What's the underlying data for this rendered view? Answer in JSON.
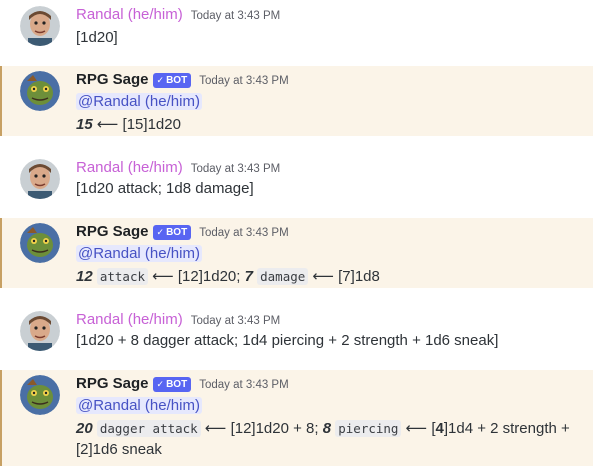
{
  "users": {
    "user": {
      "name": "Randal (he/him)"
    },
    "bot": {
      "name": "RPG Sage",
      "tag": "BOT",
      "tag_check": "✓"
    }
  },
  "messages": [
    {
      "timestamp": "Today at 3:43 PM",
      "text": "[1d20]"
    },
    {
      "timestamp": "Today at 3:43 PM",
      "mention": "@Randal (he/him)",
      "result": {
        "total": "15",
        "arrow": "⟵",
        "detail": "[15]1d20"
      }
    },
    {
      "timestamp": "Today at 3:43 PM",
      "text": "[1d20 attack; 1d8 damage]"
    },
    {
      "timestamp": "Today at 3:43 PM",
      "mention": "@Randal (he/him)",
      "result": {
        "total1": "12",
        "label1": "attack",
        "arrow": "⟵",
        "detail1": "[12]1d20;",
        "total2": "7",
        "label2": "damage",
        "detail2": "[7]1d8"
      }
    },
    {
      "timestamp": "Today at 3:43 PM",
      "text": "[1d20 + 8 dagger attack; 1d4 piercing + 2 strength + 1d6 sneak]"
    },
    {
      "timestamp": "Today at 3:43 PM",
      "mention": "@Randal (he/him)",
      "result": {
        "total1": "20",
        "label1": "dagger attack",
        "arrow": "⟵",
        "detail1": "[12]1d20 + 8;",
        "total2": "8",
        "label2": "piercing",
        "detail2a": "[",
        "detail2b": "4",
        "detail2c": "]1d4 + 2 strength +",
        "detail2d": "[2]1d6 sneak"
      }
    }
  ]
}
